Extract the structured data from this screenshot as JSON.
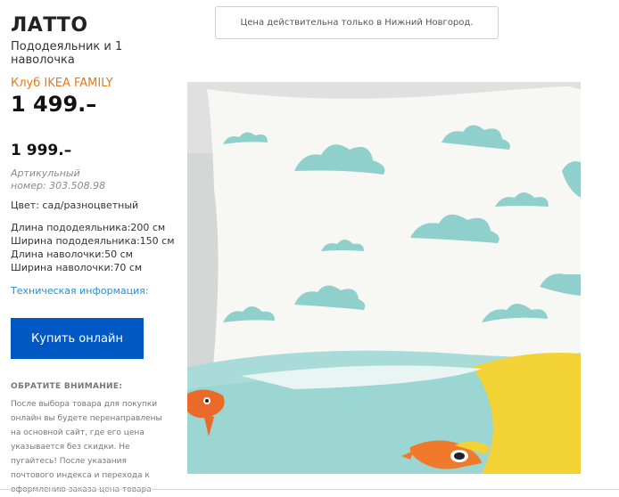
{
  "product": {
    "name": "ЛАТТО",
    "description": "Пододеяльник и 1 наволочка",
    "family_label": "Клуб IKEA FAMILY",
    "family_price": "1 499.–",
    "regular_price": "1 999.–",
    "article_label": "Артикульный",
    "article_number": "номер: 303.508.98",
    "color": "Цвет: сад/разноцветный",
    "specs": [
      "Длина пододеяльника:200 см",
      "Ширина пододеяльника:150 см",
      "Длина наволочки:50 см",
      "Ширина наволочки:70 см"
    ],
    "tech_info_link": "Техническая информация:"
  },
  "actions": {
    "buy_label": "Купить онлайн"
  },
  "notice": {
    "title": "ОБРАТИТЕ ВНИМАНИЕ:",
    "lines": [
      "После выбора товара для покупки",
      "онлайн вы будете перенаправлены",
      "на основной сайт, где его цена",
      "указывается без скидки. Не",
      "пугайтесь! После указания",
      "почтового индекса и перехода к",
      "оформлению заказа цена товара"
    ]
  },
  "banner": {
    "text": "Цена действительна только в Нижний Новгород."
  },
  "colors": {
    "accent_blue": "#0058c3",
    "family_orange": "#e07b1a",
    "link_blue": "#2a8fd1",
    "cloud_teal": "#8fcfcc",
    "sun_yellow": "#f3d235"
  }
}
